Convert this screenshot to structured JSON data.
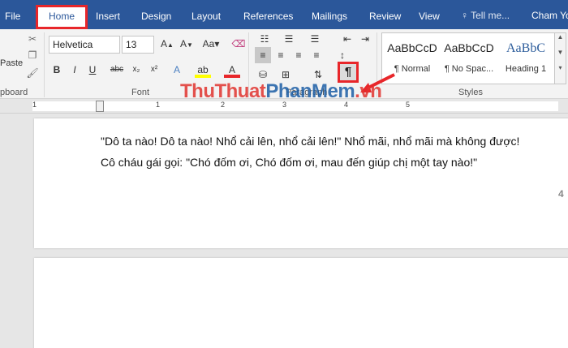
{
  "tabs": [
    {
      "label": "File"
    },
    {
      "label": "Home"
    },
    {
      "label": "Insert"
    },
    {
      "label": "Design"
    },
    {
      "label": "Layout"
    },
    {
      "label": "References"
    },
    {
      "label": "Mailings"
    },
    {
      "label": "Review"
    },
    {
      "label": "View"
    }
  ],
  "tell_me": "Tell me...",
  "user": "Cham Yo",
  "font": {
    "name": "Helvetica",
    "size": "13"
  },
  "groups": {
    "clipboard": "pboard",
    "font": "Font",
    "paragraph": "Paragraph",
    "styles": "Styles"
  },
  "clipboard_paste": "Paste",
  "styles": [
    {
      "preview": "AaBbCcD",
      "name": "¶ Normal"
    },
    {
      "preview": "AaBbCcD",
      "name": "¶ No Spac..."
    },
    {
      "preview": "AaBbC",
      "name": "Heading 1"
    }
  ],
  "pilcrow": "¶",
  "ruler_numbers": [
    "1",
    "1",
    "2",
    "3",
    "4",
    "5"
  ],
  "document": {
    "line1": "\"Dô ta nào! Dô ta nào! Nhổ cải lên, nhổ cải lên!\" Nhổ mãi, nhổ mãi mà không được!",
    "line2": "Cô cháu gái gọi: \"Chó đốm ơi, Chó đốm ơi, mau đến giúp chị một tay nào!\"",
    "page_number": "4"
  },
  "watermark": {
    "part1": "ThuThuat",
    "part2": "PhanMem",
    "part3": ".vn"
  },
  "colors": {
    "ribbon_tab_bar": "#2b579a",
    "highlight": "#e8262a"
  }
}
